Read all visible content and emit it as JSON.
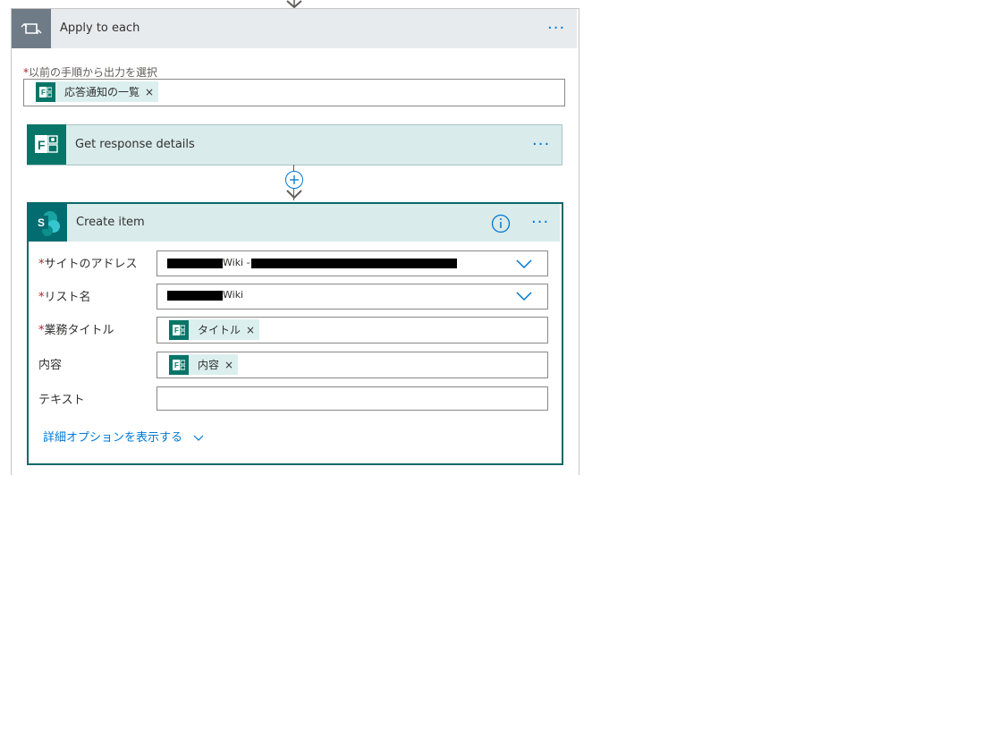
{
  "loop": {
    "title": "Apply to each",
    "select_label": "以前の手順から出力を選択",
    "required_mark": "*",
    "token_label": "応答通知の一覧",
    "token_remove": "×",
    "more": "···"
  },
  "get_response": {
    "title": "Get response details",
    "more": "···"
  },
  "create_item": {
    "title": "Create item",
    "more": "···",
    "fields": {
      "site_address": {
        "label": "サイトのアドレス",
        "value": "Wiki -"
      },
      "list_name": {
        "label": "リスト名",
        "value": "Wiki"
      },
      "task_title": {
        "label": "業務タイトル",
        "token": "タイトル",
        "remove": "×"
      },
      "content": {
        "label": "内容",
        "token": "内容",
        "remove": "×"
      },
      "text": {
        "label": "テキスト"
      }
    },
    "advanced_link": "詳細オプションを表示する"
  },
  "colors": {
    "accent": "#0078d4",
    "teal": "#077568",
    "required": "#a4262c"
  }
}
